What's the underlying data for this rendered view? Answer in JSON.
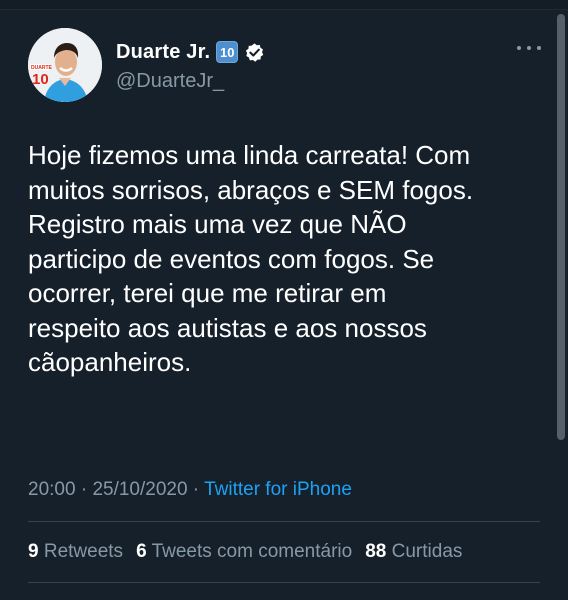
{
  "author": {
    "name": "Duarte Jr.",
    "badge": "10",
    "handle": "@DuarteJr_",
    "avatar_text": [
      "DUARTE",
      "10"
    ],
    "verified": true
  },
  "tweet": {
    "lines": [
      "Hoje fizemos uma linda carreata! Com",
      "muitos sorrisos, abraços e SEM fogos.",
      "Registro mais uma vez que NÃO",
      "participo de eventos com fogos. Se",
      "ocorrer, terei que me retirar em",
      "respeito aos autistas e aos nossos",
      "cãopanheiros."
    ],
    "time": "20:00",
    "separator": " · ",
    "date": "25/10/2020",
    "source": "Twitter for iPhone"
  },
  "stats": {
    "retweets_count": "9",
    "retweets_label": "Retweets",
    "quotes_count": "6",
    "quotes_label": "Tweets com comentário",
    "likes_count": "88",
    "likes_label": "Curtidas"
  },
  "colors": {
    "background": "#15202b",
    "text_primary": "#ffffff",
    "text_secondary": "#8899a6",
    "link": "#1da1f2",
    "divider": "#38444d"
  },
  "icons": [
    "verified-icon",
    "keycap-ten-icon",
    "more-options-icon",
    "avatar"
  ]
}
